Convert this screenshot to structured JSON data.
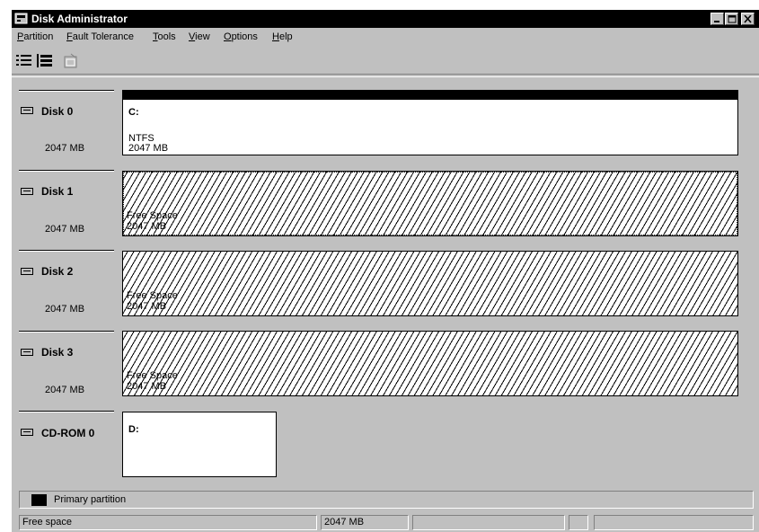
{
  "window": {
    "title": "Disk Administrator",
    "controls": {
      "minimize": "_",
      "maximize": "□",
      "close": "×"
    }
  },
  "menu": [
    {
      "label": "Partition",
      "accel": "P",
      "rest": "artition"
    },
    {
      "label": "Fault Tolerance",
      "accel": "F",
      "rest": "ault Tolerance"
    },
    {
      "label": "Tools",
      "accel": "T",
      "rest": "ools"
    },
    {
      "label": "View",
      "accel": "V",
      "rest": "iew"
    },
    {
      "label": "Options",
      "accel": "O",
      "rest": "ptions"
    },
    {
      "label": "Help",
      "accel": "H",
      "rest": "elp"
    }
  ],
  "toolbar": {
    "buttons": [
      {
        "icon": "volumes-view-icon"
      },
      {
        "icon": "disk-configuration-view-icon"
      },
      {
        "icon": "properties-icon",
        "disabled": true
      }
    ]
  },
  "disks": [
    {
      "name": "Disk 0",
      "size": "2047 MB",
      "partition": {
        "type": "primary",
        "letter": "C:",
        "fs": "NTFS",
        "size": "2047 MB"
      }
    },
    {
      "name": "Disk 1",
      "size": "2047 MB",
      "partition": {
        "type": "free",
        "label": "Free Space",
        "size": "2047 MB",
        "selected": true
      }
    },
    {
      "name": "Disk 2",
      "size": "2047 MB",
      "partition": {
        "type": "free",
        "label": "Free Space",
        "size": "2047 MB"
      }
    },
    {
      "name": "Disk 3",
      "size": "2047 MB",
      "partition": {
        "type": "free",
        "label": "Free Space",
        "size": "2047 MB"
      }
    }
  ],
  "cdrom": {
    "name": "CD-ROM 0",
    "letter": "D:"
  },
  "legend": {
    "label": "Primary partition",
    "color": "#000000"
  },
  "statusbar": {
    "text": "Free space",
    "size": "2047 MB",
    "pane3": "",
    "pane4": "",
    "pane5": ""
  }
}
